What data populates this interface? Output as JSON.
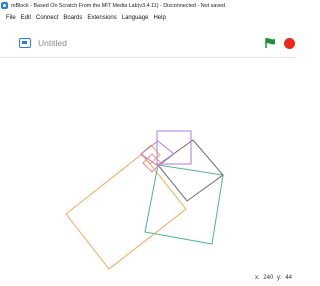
{
  "window": {
    "title": "mBlock - Based On Scratch From the MIT Media Lab(v3.4.11) - Disconnected - Not saved"
  },
  "menu": {
    "items": [
      "File",
      "Edit",
      "Connect",
      "Boards",
      "Extensions",
      "Language",
      "Help"
    ]
  },
  "toolbar": {
    "project_name": "Untitled",
    "screen_mode_icon": "screen-mode-icon",
    "green_flag_icon": "green-flag-icon",
    "stop_icon": "stop-icon"
  },
  "status": {
    "x_label": "x:",
    "x_value": "240",
    "y_label": "y:",
    "y_value": "44"
  },
  "colors": {
    "accent_blue": "#2b7bd8",
    "flag_green": "#1e8e3e",
    "stop_red": "#e8271f",
    "pen_orange": "#f0a860",
    "pen_teal": "#4fb58a",
    "pen_gray": "#6a6a6a",
    "pen_purple": "#b27bd9"
  }
}
